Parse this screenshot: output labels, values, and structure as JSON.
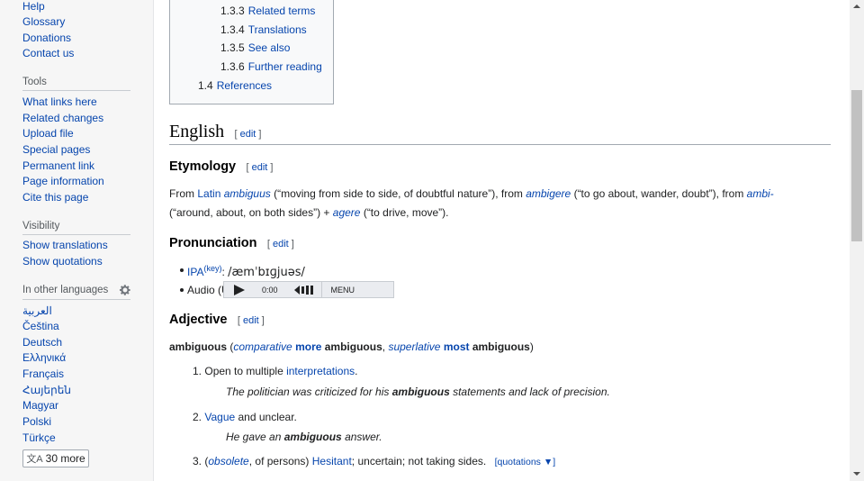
{
  "sidebar": {
    "nav_links": [
      "Help",
      "Glossary",
      "Donations",
      "Contact us"
    ],
    "tools_heading": "Tools",
    "tools_links": [
      "What links here",
      "Related changes",
      "Upload file",
      "Special pages",
      "Permanent link",
      "Page information",
      "Cite this page"
    ],
    "visibility_heading": "Visibility",
    "visibility_links": [
      "Show translations",
      "Show quotations"
    ],
    "languages_heading": "In other languages",
    "languages": [
      "العربية",
      "Čeština",
      "Deutsch",
      "Ελληνικά",
      "Français",
      "Հայերեն",
      "Magyar",
      "Polski",
      "Türkçe"
    ],
    "more_languages_label": "30 more"
  },
  "toc": [
    {
      "num": "1.3.3",
      "label": "Related terms"
    },
    {
      "num": "1.3.4",
      "label": "Translations"
    },
    {
      "num": "1.3.5",
      "label": "See also"
    },
    {
      "num": "1.3.6",
      "label": "Further reading"
    },
    {
      "num": "1.4",
      "label": "References"
    }
  ],
  "edit_label": "edit",
  "heading_english": "English",
  "heading_etymology": "Etymology",
  "etymology": {
    "line1": {
      "t1": "From ",
      "latin": "Latin",
      "t2": " ",
      "ambiguus": "ambiguus",
      "t3": " (“moving from side to side, of doubtful nature”), from ",
      "ambigere": "ambigere",
      "t4": " (“to go about, wander, doubt”), from ",
      "ambi": "ambi-"
    },
    "line2": {
      "t1": "(“around, about, on both sides”) + ",
      "agere": "agere",
      "t2": " (“to drive, move”)."
    }
  },
  "heading_pronunciation": "Pronunciation",
  "pronunciation": {
    "ipa_label": "IPA",
    "key_label": "(key)",
    "ipa_colon": ":",
    "ipa_value": "/æmˈbɪɡjuəs/",
    "audio_label": "Audio (US)",
    "player": {
      "time": "0:00",
      "menu": "MENU"
    }
  },
  "heading_adjective": "Adjective",
  "headword": {
    "word": "ambiguous",
    "p1": " (",
    "comparative": "comparative",
    "more": "more",
    "word2": " ambiguous",
    "sep": ", ",
    "superlative": "superlative",
    "most": "most",
    "word3": " ambiguous",
    "p2": ")"
  },
  "senses": [
    {
      "num": "1.",
      "text": "Open to multiple ",
      "link": "interpretations",
      "end": ".",
      "example_pre": "The politician was criticized for his ",
      "example_bold": "ambiguous",
      "example_post": " statements and lack of precision."
    },
    {
      "num": "2.",
      "link": "Vague",
      "text": " and unclear.",
      "example_pre": "He gave an ",
      "example_bold": "ambiguous",
      "example_post": " answer."
    },
    {
      "num": "3.",
      "p1": "(",
      "obsolete": "obsolete",
      "p2": ", of persons) ",
      "link": "Hesitant",
      "text": "; uncertain; not taking sides.",
      "quotations": "[quotations ▼]"
    }
  ],
  "colors": {
    "link": "#0645ad",
    "text": "#202122",
    "muted": "#54595d"
  }
}
